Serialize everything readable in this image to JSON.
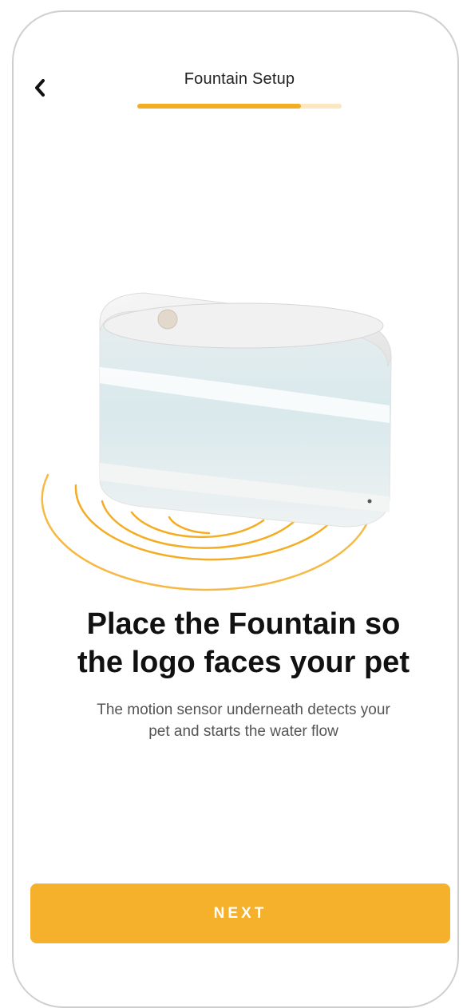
{
  "header": {
    "back_icon": "chevron-left-icon",
    "title": "Fountain Setup",
    "progress_fraction": 0.8
  },
  "main": {
    "headline_line1": "Place the Fountain so",
    "headline_line2": "the logo faces your pet",
    "subtext_line1": "The motion sensor underneath detects your",
    "subtext_line2": "pet and starts the water flow"
  },
  "footer": {
    "next_label": "NEXT"
  },
  "colors": {
    "accent": "#f5b12c",
    "accent_light": "#fbe7c0",
    "wave": "#f4ad22"
  }
}
